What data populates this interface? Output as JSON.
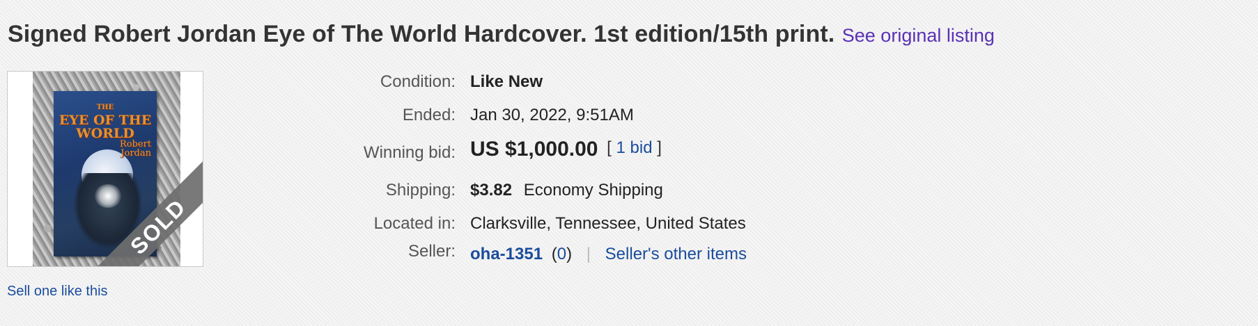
{
  "listing": {
    "title": "Signed Robert Jordan Eye of The World Hardcover. 1st edition/15th print.",
    "original_link": "See original listing"
  },
  "image": {
    "badge": "SOLD",
    "cover_small": "THE",
    "cover_title_1": "EYE OF THE",
    "cover_title_2": "WORLD",
    "cover_author_1": "Robert",
    "cover_author_2": "Jordan"
  },
  "sell_link": "Sell one like this",
  "details": {
    "condition_label": "Condition:",
    "condition_value": "Like New",
    "ended_label": "Ended:",
    "ended_date": "Jan 30, 2022",
    "ended_sep": ",",
    "ended_time": "9:51AM",
    "winning_label": "Winning bid:",
    "winning_value": "US $1,000.00",
    "bid_open": "[",
    "bid_count": "1 bid",
    "bid_close": "]",
    "shipping_label": "Shipping:",
    "shipping_cost": "$3.82",
    "shipping_method": "Economy Shipping",
    "location_label": "Located in:",
    "location_value": "Clarksville, Tennessee, United States",
    "seller_label": "Seller:",
    "seller_name": "oha-1351",
    "seller_feedback_open": "(",
    "seller_feedback": "0",
    "seller_feedback_close": ")",
    "seller_divider": "|",
    "seller_other": "Seller's other items"
  },
  "colors": {
    "link": "#1a4c9c",
    "visited_link": "#5a31b5",
    "background": "#f2f2f2"
  }
}
